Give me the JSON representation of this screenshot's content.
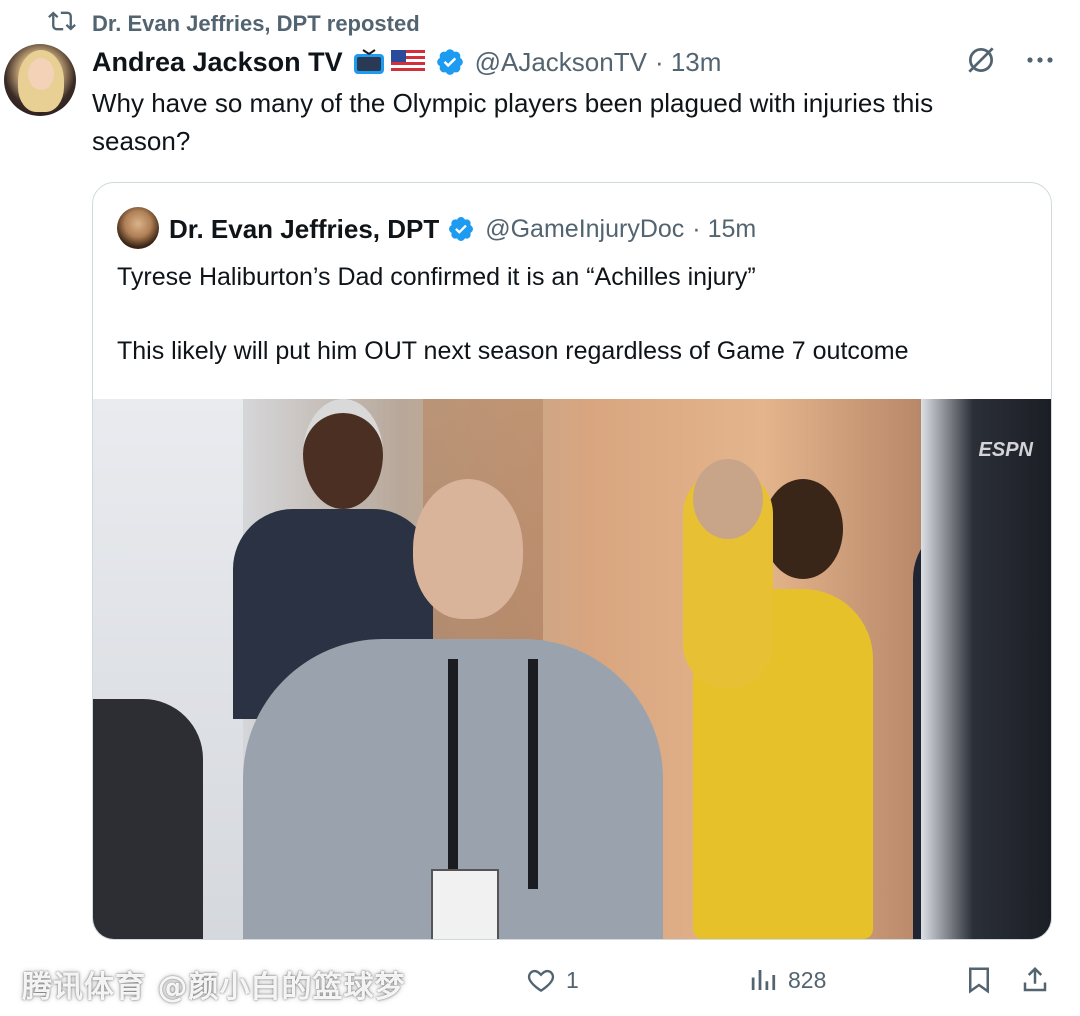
{
  "repost": {
    "text": "Dr. Evan Jeffries, DPT reposted",
    "icon": "repost-icon"
  },
  "tweet": {
    "author_name": "Andrea Jackson TV",
    "handle": "@AJacksonTV",
    "time": "· 13m",
    "emojis": [
      "television-emoji",
      "us-flag-emoji"
    ],
    "verified": true,
    "text_lines": [
      "Why have so many of the Olympic players been plagued with injuries this",
      "season?"
    ]
  },
  "quoted": {
    "author_name": "Dr. Evan Jeffries, DPT",
    "handle": "@GameInjuryDoc",
    "time": "· 15m",
    "verified": true,
    "paragraphs": [
      "Tyrese Haliburton’s Dad confirmed it is an “Achilles injury”",
      "This likely will put him OUT next season regardless of Game 7 outcome"
    ],
    "media_overlay_text": "ESPN"
  },
  "actions": {
    "likes": "1",
    "views": "828"
  },
  "watermark": "腾讯体育 @颜小白的篮球梦",
  "colors": {
    "text": "#0f1419",
    "secondary": "#536471",
    "verified": "#1d9bf0",
    "border": "#cfd9de"
  }
}
